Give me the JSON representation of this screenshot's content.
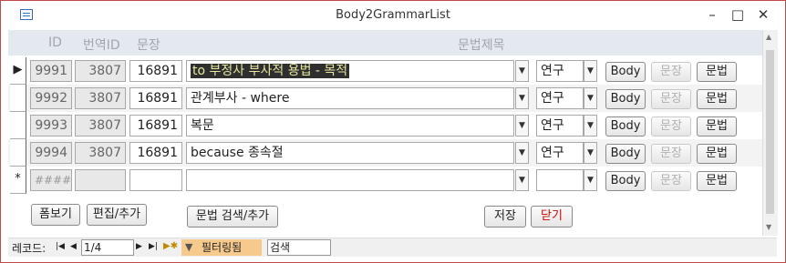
{
  "window": {
    "title": "Body2GrammarList"
  },
  "header": {
    "id": "ID",
    "translation_id": "번역ID",
    "sentence": "문장",
    "grammar_title": "문법제목"
  },
  "rows": [
    {
      "id": "9991",
      "translation_id": "3807",
      "sentence": "16891",
      "grammar": "to 부정사 부사적 용법 - 목적",
      "type": "연구"
    },
    {
      "id": "9992",
      "translation_id": "3807",
      "sentence": "16891",
      "grammar": "관계부사 - where",
      "type": "연구"
    },
    {
      "id": "9993",
      "translation_id": "3807",
      "sentence": "16891",
      "grammar": "복문",
      "type": "연구"
    },
    {
      "id": "9994",
      "translation_id": "3807",
      "sentence": "16891",
      "grammar": "because 종속절",
      "type": "연구"
    }
  ],
  "new_row": {
    "marker": "*",
    "id": "#####"
  },
  "row_buttons": {
    "body": "Body",
    "sentence": "문장",
    "grammar": "문법"
  },
  "footer_buttons": {
    "form_view": "폼보기",
    "edit_add": "편집/추가",
    "grammar_search": "문법 검색/추가",
    "save": "저장",
    "close": "닫기"
  },
  "navigation": {
    "record_label": "레코드:",
    "record_value": "1/4",
    "filter_label": "필터링됨",
    "search_placeholder": "검색"
  },
  "colors": {
    "accent_border": "#c04a48",
    "header_bg": "#e4e8ef",
    "filter_bg": "#f6c98c",
    "close_text": "#d10000"
  }
}
